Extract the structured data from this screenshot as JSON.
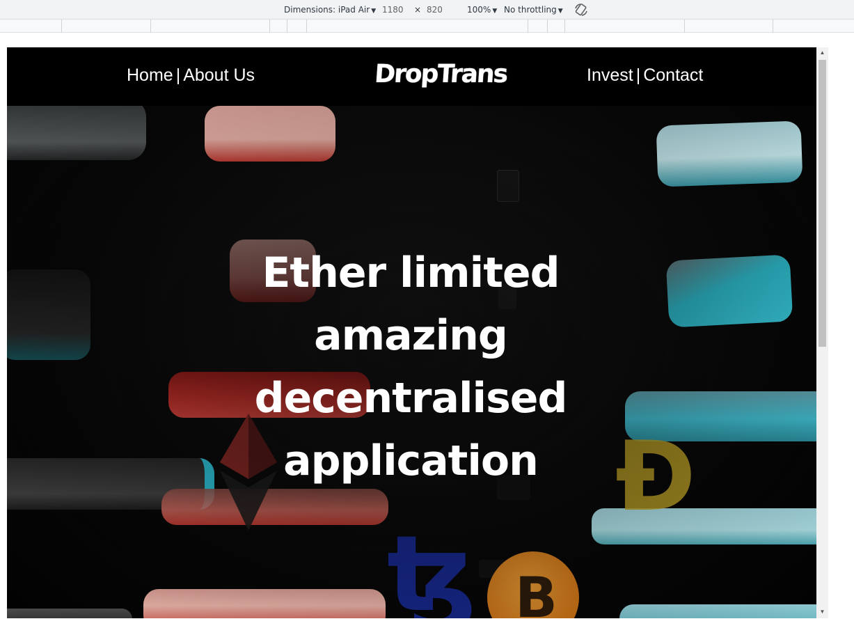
{
  "devtools": {
    "dimensions_label": "Dimensions: iPad Air",
    "width": "1180",
    "times": "×",
    "height": "820",
    "zoom": "100%",
    "throttling": "No throttling",
    "rotate_icon": "rotate-icon"
  },
  "nav": {
    "home": "Home",
    "separator": "|",
    "about": "About Us",
    "logo": "DropTrans",
    "invest": "Invest",
    "contact": "Contact"
  },
  "hero": {
    "title_lines": [
      "Ether limited",
      "amazing",
      "decentralised",
      "application"
    ]
  },
  "background_symbols": {
    "dogecoin": "Ð",
    "bitcoin": "B",
    "tezos": "ꜩ"
  },
  "colors": {
    "accent_teal": "#3fb7c9",
    "accent_red": "#e0473f",
    "accent_pink": "#e2a39a",
    "doge_yellow": "#b59a25",
    "bitcoin_orange": "#e38a1f",
    "tezos_blue": "#1b2fa8"
  }
}
